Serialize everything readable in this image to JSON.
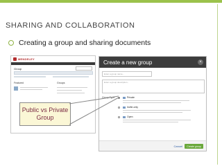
{
  "slide": {
    "title": "SHARING AND COLLABORATION",
    "bullet": "Creating a group and sharing documents",
    "accent_color": "#9bc24c"
  },
  "left_screenshot": {
    "logo_text": "MENDELEY",
    "page_title": "Group",
    "section_left": "Featured",
    "section_right": "Groups"
  },
  "callout": {
    "line1": "Public vs Private",
    "line2": "Group"
  },
  "dialog": {
    "title": "Create a new group",
    "name_placeholder": "Enter a group name...",
    "desc_placeholder": "Enter a group description...",
    "group_type_label": "Group Type:",
    "options": [
      {
        "label": "Private",
        "selected": true
      },
      {
        "label": "Invite-only",
        "selected": false
      },
      {
        "label": "Open",
        "selected": false
      }
    ],
    "cancel_label": "Cancel",
    "create_label": "Create group"
  }
}
